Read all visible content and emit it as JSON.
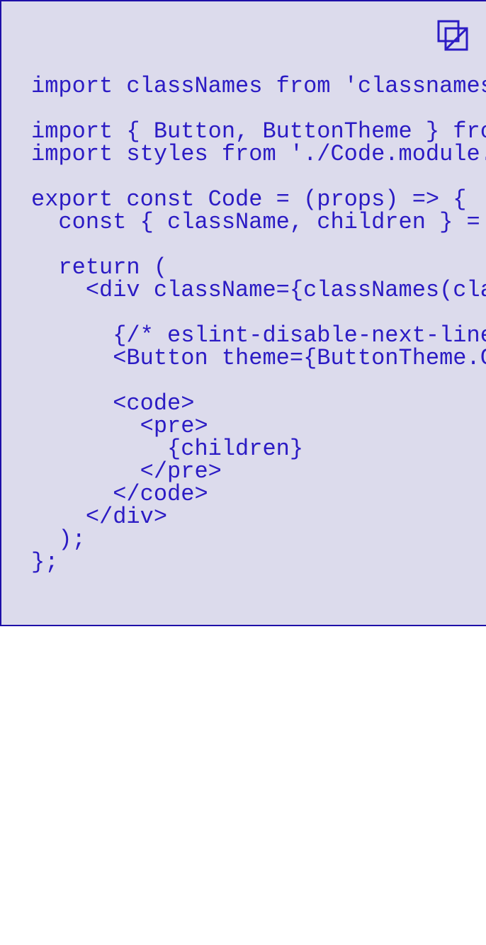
{
  "code_block": {
    "copy_icon": "copy-icon",
    "lines": [
      "import classNames from 'classnames';",
      "",
      "import { Button, ButtonTheme } from",
      "import styles from './Code.module.",
      "",
      "export const Code = (props) => {",
      "  const { className, children } = ",
      "",
      "  return (",
      "    <div className={classNames(cla",
      "",
      "      {/* eslint-disable-next-line",
      "      <Button theme={ButtonTheme.C",
      "",
      "      <code>",
      "        <pre>",
      "          {children}",
      "        </pre>",
      "      </code>",
      "    </div>",
      "  );",
      "};"
    ]
  },
  "colors": {
    "background": "#dcdbec",
    "border": "#1e0fa8",
    "text": "#2b1bc4"
  }
}
